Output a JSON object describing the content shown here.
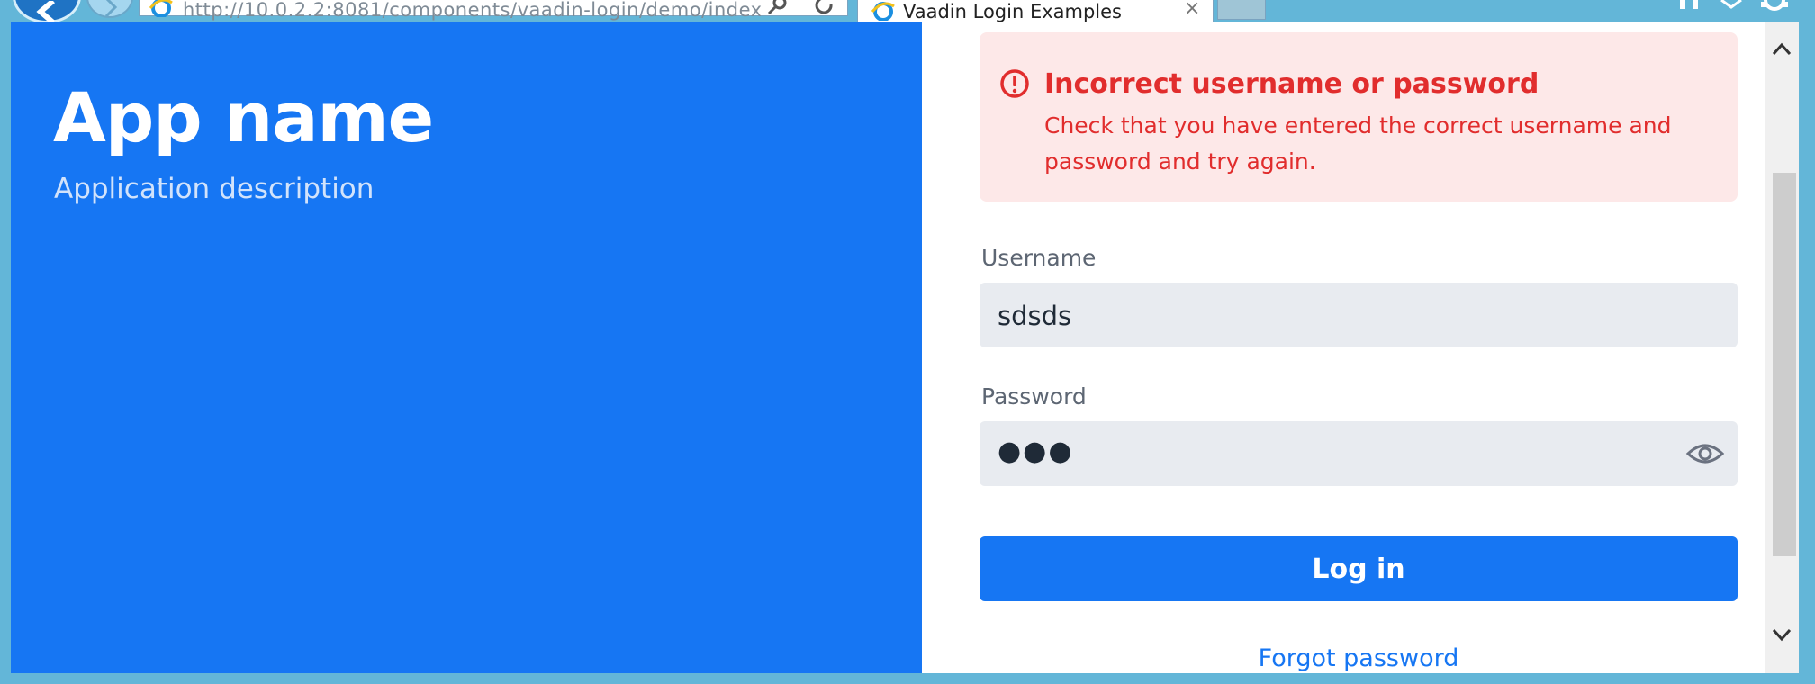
{
  "browser": {
    "address_url": "http://10.0.2.2:8081/components/vaadin-login/demo/index",
    "tab_title": "Vaadin Login Examples",
    "tab_close": "×"
  },
  "brand": {
    "title": "App name",
    "description": "Application description",
    "color": "#1676f3"
  },
  "error": {
    "title": "Incorrect username or password",
    "message": "Check that you have entered the correct username and password and try again.",
    "color": "#e12d2d",
    "background": "#fde8e8"
  },
  "form": {
    "username_label": "Username",
    "username_value": "sdsds",
    "password_label": "Password",
    "password_mask": "●●●",
    "login_label": "Log in",
    "forgot_label": "Forgot password"
  }
}
